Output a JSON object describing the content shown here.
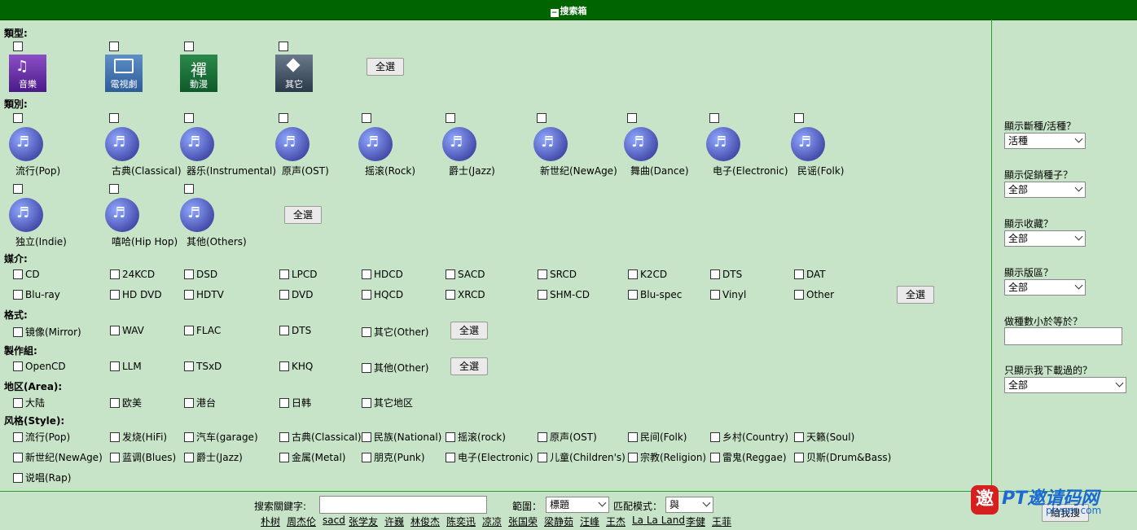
{
  "header": {
    "title": "搜索箱"
  },
  "type_section": {
    "label": "類型:",
    "items": [
      {
        "caption": "音樂"
      },
      {
        "caption": "電視劇"
      },
      {
        "caption": "禪",
        "sub": "動漫"
      },
      {
        "caption": "其它"
      }
    ],
    "select_all": "全選"
  },
  "category_section": {
    "label": "類別:",
    "items": [
      "流行(Pop)",
      "古典(Classical)",
      "器乐(Instrumental)",
      "原声(OST)",
      "摇滚(Rock)",
      "爵士(Jazz)",
      "新世纪(NewAge)",
      "舞曲(Dance)",
      "电子(Electronic)",
      "民谣(Folk)",
      "独立(Indie)",
      "嘻哈(Hip Hop)",
      "其他(Others)"
    ],
    "select_all": "全選"
  },
  "media_section": {
    "label": "媒介:",
    "row1": [
      "CD",
      "24KCD",
      "DSD",
      "LPCD",
      "HDCD",
      "SACD",
      "SRCD",
      "K2CD",
      "DTS",
      "DAT"
    ],
    "row2": [
      "Blu-ray",
      "HD DVD",
      "HDTV",
      "DVD",
      "HQCD",
      "XRCD",
      "SHM-CD",
      "Blu-spec",
      "Vinyl",
      "Other"
    ],
    "select_all": "全選"
  },
  "format_section": {
    "label": "格式:",
    "items": [
      "镜像(Mirror)",
      "WAV",
      "FLAC",
      "DTS",
      "其它(Other)"
    ],
    "select_all": "全選"
  },
  "team_section": {
    "label": "製作組:",
    "items": [
      "OpenCD",
      "LLM",
      "TSxD",
      "KHQ",
      "其他(Other)"
    ],
    "select_all": "全選"
  },
  "area_section": {
    "label": "地区(Area):",
    "items": [
      "大陆",
      "欧美",
      "港台",
      "日韩",
      "其它地区"
    ]
  },
  "style_section": {
    "label": "风格(Style):",
    "row1": [
      "流行(Pop)",
      "发烧(HiFi)",
      "汽车(garage)",
      "古典(Classical)",
      "民族(National)",
      "摇滚(rock)",
      "原声(OST)",
      "民间(Folk)",
      "乡村(Country)",
      "天籁(Soul)"
    ],
    "row2": [
      "新世纪(NewAge)",
      "蓝调(Blues)",
      "爵士(Jazz)",
      "金属(Metal)",
      "朋克(Punk)",
      "电子(Electronic)",
      "儿童(Children's)",
      "宗教(Religion)",
      "雷鬼(Reggae)",
      "贝斯(Drum&Bass)"
    ],
    "row3": [
      "说唱(Rap)"
    ]
  },
  "sidebar": {
    "new_torrent": {
      "label": "顯示斷種/活種？",
      "value": "活種"
    },
    "promo": {
      "label": "顯示促銷種子？",
      "value": "全部"
    },
    "bookmark": {
      "label": "顯示收藏？",
      "value": "全部"
    },
    "board": {
      "label": "顯示版區？",
      "value": "全部"
    },
    "seeders": {
      "label": "做種數小於等於？",
      "value": ""
    },
    "downloaded": {
      "label": "只顯示我下載過的？",
      "value": "全部"
    }
  },
  "search": {
    "keyword_label": "搜索關鍵字:",
    "keyword_value": "",
    "scope_label": "範圍：",
    "scope_value": "標題",
    "match_label": "匹配模式：",
    "match_value": "與",
    "submit": "給我搜"
  },
  "hot_links": [
    "朴树",
    "周杰伦",
    "sacd",
    "张学友",
    "许巍",
    "林俊杰",
    "陈奕迅",
    "凉凉",
    "张国荣",
    "梁静茹",
    "汪峰",
    "王杰",
    "La La Land",
    "李健",
    "王菲"
  ],
  "watermark": {
    "text": "PT邀请码网",
    "sub": "ptyqm.com",
    "seal": "邀"
  }
}
